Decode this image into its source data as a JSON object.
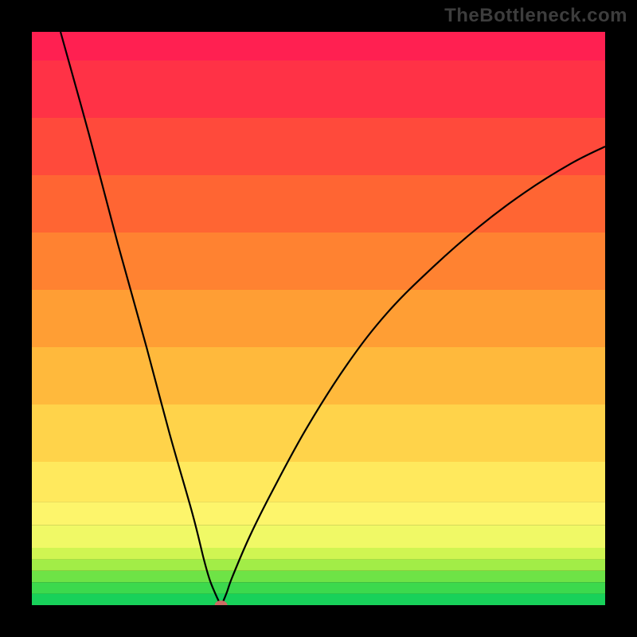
{
  "watermark": "TheBottleneck.com",
  "chart_data": {
    "type": "line",
    "title": "",
    "xlabel": "",
    "ylabel": "",
    "xlim": [
      0,
      100
    ],
    "ylim": [
      0,
      100
    ],
    "grid": false,
    "legend": false,
    "gradient_bands": [
      {
        "y0": 0,
        "y1": 2,
        "color": "#18d15a"
      },
      {
        "y0": 2,
        "y1": 4,
        "color": "#3cd94d"
      },
      {
        "y0": 4,
        "y1": 6,
        "color": "#6ee346"
      },
      {
        "y0": 6,
        "y1": 8,
        "color": "#a2ed47"
      },
      {
        "y0": 8,
        "y1": 10,
        "color": "#d0f552"
      },
      {
        "y0": 10,
        "y1": 14,
        "color": "#f0f966"
      },
      {
        "y0": 14,
        "y1": 18,
        "color": "#fdf56b"
      },
      {
        "y0": 18,
        "y1": 25,
        "color": "#ffe95d"
      },
      {
        "y0": 25,
        "y1": 35,
        "color": "#ffd34a"
      },
      {
        "y0": 35,
        "y1": 45,
        "color": "#ffb93c"
      },
      {
        "y0": 45,
        "y1": 55,
        "color": "#ff9e34"
      },
      {
        "y0": 55,
        "y1": 65,
        "color": "#ff8231"
      },
      {
        "y0": 65,
        "y1": 75,
        "color": "#ff6533"
      },
      {
        "y0": 75,
        "y1": 85,
        "color": "#ff4a3b"
      },
      {
        "y0": 85,
        "y1": 95,
        "color": "#ff3246"
      },
      {
        "y0": 95,
        "y1": 100,
        "color": "#ff2051"
      }
    ],
    "series": [
      {
        "name": "curve",
        "color": "#000000",
        "x": [
          5,
          10,
          15,
          20,
          24,
          28,
          30,
          31,
          32,
          32.7,
          33,
          33.3,
          34,
          35,
          38,
          42,
          48,
          55,
          62,
          70,
          78,
          86,
          94,
          100
        ],
        "y": [
          100,
          82,
          63,
          45,
          30,
          16,
          8,
          4.5,
          2,
          0.5,
          0,
          0.5,
          2.2,
          5,
          12,
          20,
          31,
          42,
          51,
          59,
          66,
          72,
          77,
          80
        ]
      }
    ],
    "marker": {
      "x": 33,
      "y": 0,
      "rx": 1.1,
      "ry": 0.8,
      "color": "#cd6b64"
    }
  }
}
